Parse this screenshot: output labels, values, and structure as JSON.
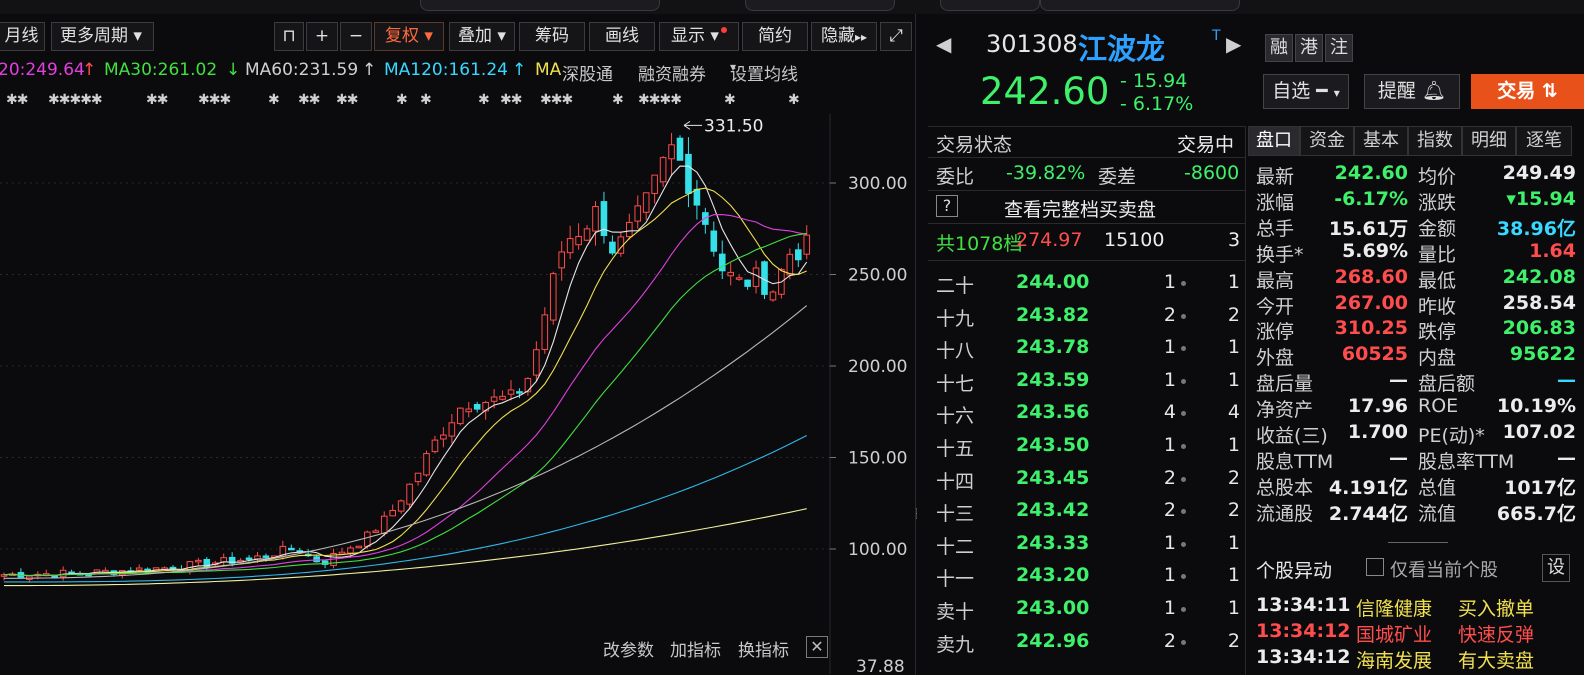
{
  "toolbar": {
    "monthly": "月线",
    "more_periods": "更多周期",
    "adjust": "复权",
    "overlay": "叠加",
    "chips": "筹码",
    "draw": "画线",
    "display": "显示",
    "simple": "简约",
    "hide": "隐藏"
  },
  "ma_legend": {
    "ma20": "20:249.64",
    "ma20_arrow": "↑",
    "ma30": "MA30:261.02",
    "ma30_arrow": "↓",
    "ma60": "MA60:231.59",
    "ma60_arrow": "↑",
    "ma120": "MA120:161.24",
    "ma120_arrow": "↑",
    "ma_label": "MA",
    "sz_connect": "深股通",
    "margin": "融资融券",
    "settings": "设置均线"
  },
  "chart": {
    "high_marker": "331.50",
    "y_ticks": [
      "300.00",
      "250.00",
      "200.00",
      "150.00",
      "100.00",
      "37.88"
    ],
    "colors": {
      "up": "#ff4a4a",
      "down": "#35e0e8",
      "ma5": "#e6e6e6",
      "ma10": "#f0e050",
      "ma20": "#e040e0",
      "ma30": "#40e040",
      "ma60": "#b8b8b8",
      "ma120": "#30b8e8",
      "ma250": "#f0f0a0"
    }
  },
  "chart_bottom": {
    "params": "改参数",
    "add_indicator": "加指标",
    "switch_indicator": "换指标"
  },
  "stock": {
    "code": "301308",
    "name": "江波龙",
    "t_mark": "T",
    "tag1": "融",
    "tag2": "港",
    "tag3": "注",
    "price": "242.60",
    "change": "- 15.94",
    "change_pct": "- 6.17%",
    "watchlist": "自选",
    "alert": "提醒",
    "trade": "交易"
  },
  "orderbook": {
    "status_label": "交易状态",
    "status_value": "交易中",
    "weibi_label": "委比",
    "weibi_value": "-39.82%",
    "weicha_label": "委差",
    "weicha_value": "-8600",
    "full_depth": "查看完整档买卖盘",
    "total_label": "共1078档",
    "total_price": "274.97",
    "total_vol": "15100",
    "total_cnt": "3",
    "levels": [
      {
        "label": "二十",
        "price": "244.00",
        "vol": "1",
        "cnt": "1"
      },
      {
        "label": "十九",
        "price": "243.82",
        "vol": "2",
        "cnt": "2"
      },
      {
        "label": "十八",
        "price": "243.78",
        "vol": "1",
        "cnt": "1"
      },
      {
        "label": "十七",
        "price": "243.59",
        "vol": "1",
        "cnt": "1"
      },
      {
        "label": "十六",
        "price": "243.56",
        "vol": "4",
        "cnt": "4"
      },
      {
        "label": "十五",
        "price": "243.50",
        "vol": "1",
        "cnt": "1"
      },
      {
        "label": "十四",
        "price": "243.45",
        "vol": "2",
        "cnt": "2"
      },
      {
        "label": "十三",
        "price": "243.42",
        "vol": "2",
        "cnt": "2"
      },
      {
        "label": "十二",
        "price": "243.33",
        "vol": "1",
        "cnt": "1"
      },
      {
        "label": "十一",
        "price": "243.20",
        "vol": "1",
        "cnt": "1"
      },
      {
        "label": "卖十",
        "price": "243.00",
        "vol": "1",
        "cnt": "1"
      },
      {
        "label": "卖九",
        "price": "242.96",
        "vol": "2",
        "cnt": "2"
      }
    ]
  },
  "tabs": [
    "盘口",
    "资金",
    "基本",
    "指数",
    "明细",
    "逐笔"
  ],
  "quote": [
    {
      "l1": "最新",
      "v1": "242.60",
      "c1": "green",
      "l2": "均价",
      "v2": "249.49",
      "c2": "white"
    },
    {
      "l1": "涨幅",
      "v1": "-6.17%",
      "c1": "green",
      "l2": "涨跌",
      "v2": "▾15.94",
      "c2": "green"
    },
    {
      "l1": "总手",
      "v1": "15.61万",
      "c1": "white",
      "l2": "金额",
      "v2": "38.96亿",
      "c2": "cyan"
    },
    {
      "l1": "换手*",
      "v1": "5.69%",
      "c1": "white",
      "l2": "量比",
      "v2": "1.64",
      "c2": "red"
    },
    {
      "l1": "最高",
      "v1": "268.60",
      "c1": "red",
      "l2": "最低",
      "v2": "242.08",
      "c2": "green"
    },
    {
      "l1": "今开",
      "v1": "267.00",
      "c1": "red",
      "l2": "昨收",
      "v2": "258.54",
      "c2": "white"
    },
    {
      "l1": "涨停",
      "v1": "310.25",
      "c1": "red",
      "l2": "跌停",
      "v2": "206.83",
      "c2": "green"
    },
    {
      "l1": "外盘",
      "v1": "60525",
      "c1": "red",
      "l2": "内盘",
      "v2": "95622",
      "c2": "green"
    },
    {
      "l1": "盘后量",
      "v1": "—",
      "c1": "white",
      "l2": "盘后额",
      "v2": "—",
      "c2": "cyan"
    },
    {
      "l1": "净资产",
      "v1": "17.96",
      "c1": "white",
      "l2": "ROE",
      "v2": "10.19%",
      "c2": "white"
    },
    {
      "l1": "收益(三)",
      "v1": "1.700",
      "c1": "white",
      "l2": "PE(动)*",
      "v2": "107.02",
      "c2": "white"
    },
    {
      "l1": "股息TTM",
      "v1": "—",
      "c1": "white",
      "l2": "股息率TTM",
      "v2": "—",
      "c2": "white"
    },
    {
      "l1": "总股本",
      "v1": "4.191亿",
      "c1": "white",
      "l2": "总值",
      "v2": "1017亿",
      "c2": "white"
    },
    {
      "l1": "流通股",
      "v1": "2.744亿",
      "c1": "white",
      "l2": "流值",
      "v2": "665.7亿",
      "c2": "white"
    }
  ],
  "movers": {
    "title": "个股异动",
    "only_current": "仅看当前个股",
    "settings": "设",
    "rows": [
      {
        "time": "13:34:11",
        "tcolor": "white",
        "stock": "信隆健康",
        "event": "买入撤单",
        "ecolor": "#f0e050"
      },
      {
        "time": "13:34:12",
        "tcolor": "red",
        "stock": "国城矿业",
        "event": "快速反弹",
        "ecolor": "#ff4d4d"
      },
      {
        "time": "13:34:12",
        "tcolor": "white",
        "stock": "海南发展",
        "event": "有大卖盘",
        "ecolor": "#f0e050"
      }
    ]
  }
}
